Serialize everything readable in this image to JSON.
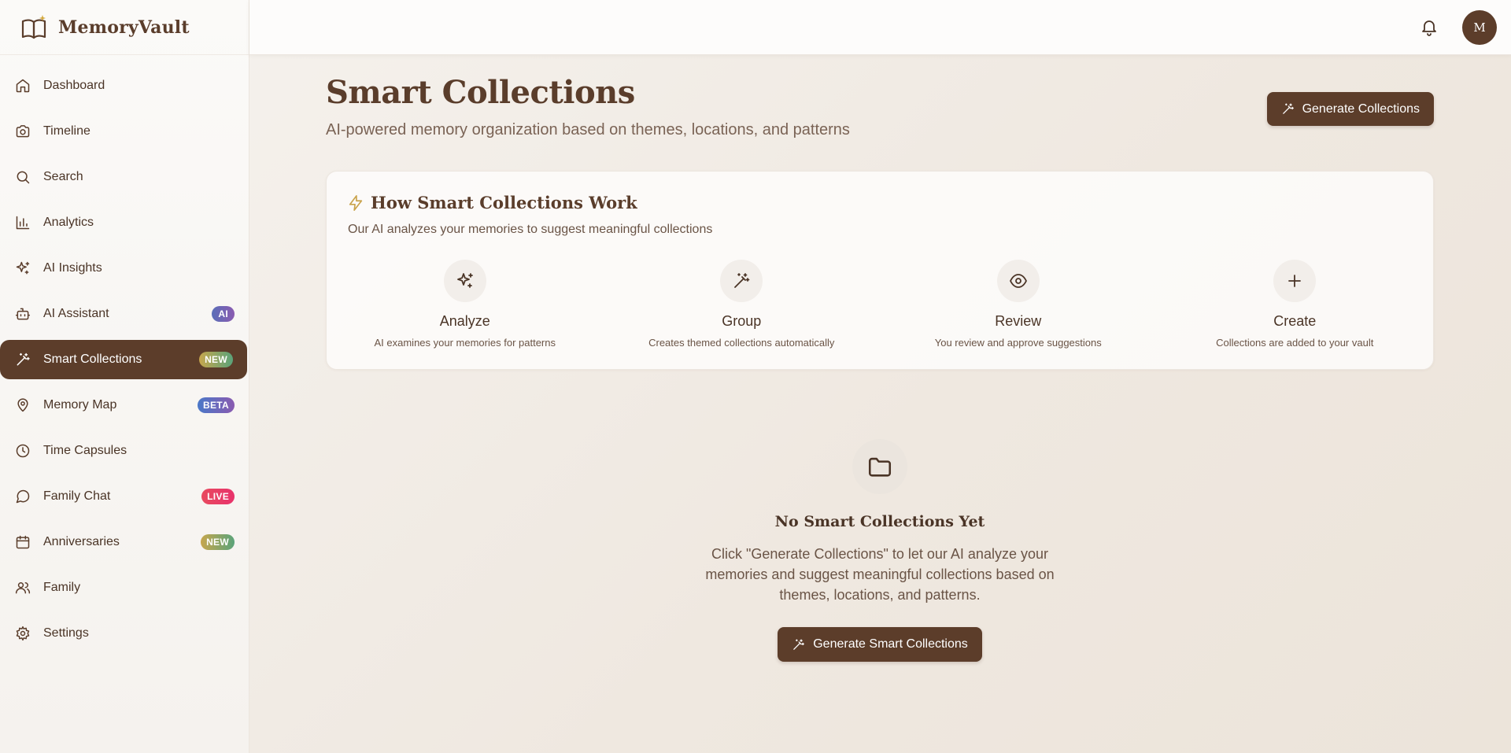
{
  "app": {
    "name": "MemoryVault"
  },
  "sidebar": {
    "items": [
      {
        "label": "Dashboard",
        "icon": "home-icon",
        "badge": ""
      },
      {
        "label": "Timeline",
        "icon": "camera-icon",
        "badge": ""
      },
      {
        "label": "Search",
        "icon": "search-icon",
        "badge": ""
      },
      {
        "label": "Analytics",
        "icon": "bar-chart-icon",
        "badge": ""
      },
      {
        "label": "AI Insights",
        "icon": "sparkles-icon",
        "badge": ""
      },
      {
        "label": "AI Assistant",
        "icon": "robot-icon",
        "badge": "AI"
      },
      {
        "label": "Smart Collections",
        "icon": "wand-icon",
        "badge": "NEW",
        "active": true
      },
      {
        "label": "Memory Map",
        "icon": "map-pin-icon",
        "badge": "BETA"
      },
      {
        "label": "Time Capsules",
        "icon": "clock-icon",
        "badge": ""
      },
      {
        "label": "Family Chat",
        "icon": "chat-icon",
        "badge": "LIVE"
      },
      {
        "label": "Anniversaries",
        "icon": "calendar-icon",
        "badge": "NEW"
      },
      {
        "label": "Family",
        "icon": "users-icon",
        "badge": ""
      },
      {
        "label": "Settings",
        "icon": "gear-icon",
        "badge": ""
      }
    ]
  },
  "topbar": {
    "avatar_initial": "M",
    "bell_icon": "bell-icon"
  },
  "main": {
    "title": "Smart Collections",
    "subtitle": "AI-powered memory organization based on themes, locations, and patterns",
    "generate_button": "Generate Collections",
    "how": {
      "title": "How Smart Collections Work",
      "description": "Our AI analyzes your memories to suggest meaningful collections",
      "steps": [
        {
          "name": "Analyze",
          "desc": "AI examines your memories for patterns",
          "icon": "sparkles-icon"
        },
        {
          "name": "Group",
          "desc": "Creates themed collections automatically",
          "icon": "wand-icon"
        },
        {
          "name": "Review",
          "desc": "You review and approve suggestions",
          "icon": "eye-icon"
        },
        {
          "name": "Create",
          "desc": "Collections are added to your vault",
          "icon": "plus-icon"
        }
      ]
    },
    "empty": {
      "title": "No Smart Collections Yet",
      "description": "Click \"Generate Collections\" to let our AI analyze your memories and suggest meaningful collections based on themes, locations, and patterns.",
      "button": "Generate Smart Collections"
    }
  },
  "colors": {
    "primary": "#5c3d2a",
    "accent_gold": "#c9a24a",
    "text": "#5a3d2b",
    "badge_live": "#e8326b"
  }
}
